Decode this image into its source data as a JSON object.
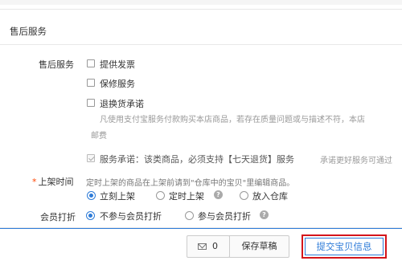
{
  "section": {
    "title": "售后服务"
  },
  "after_sales": {
    "label": "售后服务",
    "options": [
      {
        "label": "提供发票",
        "checked": false
      },
      {
        "label": "保修服务",
        "checked": false
      },
      {
        "label": "退换货承诺",
        "checked": false
      }
    ],
    "return_note_line1": "凡使用支付宝服务付款购买本店商品，若存在质量问题或与描述不符，本店",
    "return_note_line2": "邮费",
    "service_promise": {
      "label": "服务承诺：该类商品，必须支持【七天退货】服务",
      "checked": true,
      "side_note": "承诺更好服务可通过"
    }
  },
  "listing_time": {
    "required_mark": "*",
    "label": "上架时间",
    "hint": "定时上架的商品在上架前请到\"仓库中的宝贝\"里编辑商品。",
    "options": [
      {
        "label": "立刻上架",
        "selected": true
      },
      {
        "label": "定时上架",
        "selected": false,
        "help_icon": "?"
      },
      {
        "label": "放入仓库",
        "selected": false
      }
    ]
  },
  "member_discount": {
    "label": "会员打折",
    "options": [
      {
        "label": "不参与会员打折",
        "selected": true
      },
      {
        "label": "参与会员打折",
        "selected": false,
        "help_icon": "?"
      }
    ]
  },
  "footer": {
    "message_icon": "envelope-icon",
    "message_count": "0",
    "save_draft": "保存草稿",
    "submit": "提交宝贝信息"
  },
  "colors": {
    "accent": "#2d7bd8",
    "highlight_border": "#d4141a",
    "required": "#ff4400"
  }
}
